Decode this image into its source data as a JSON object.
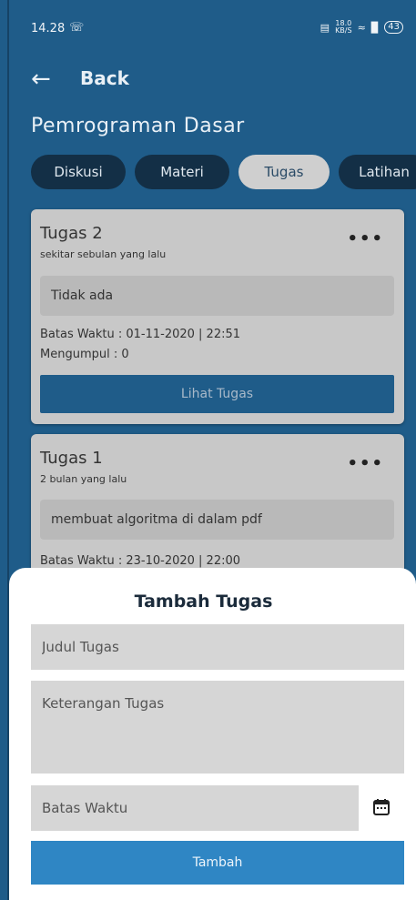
{
  "status_bar": {
    "time": "14.28",
    "speed_top": "18.0",
    "speed_bottom": "KB/S",
    "battery": "43"
  },
  "header": {
    "back_label": "Back"
  },
  "course_title": "Pemrograman Dasar",
  "tabs": [
    {
      "label": "Diskusi",
      "active": false
    },
    {
      "label": "Materi",
      "active": false
    },
    {
      "label": "Tugas",
      "active": true
    },
    {
      "label": "Latihan",
      "active": false
    }
  ],
  "tasks": [
    {
      "title": "Tugas 2",
      "time_ago": "sekitar sebulan yang lalu",
      "description": "Tidak ada",
      "deadline": "Batas Waktu : 01-11-2020 | 22:51",
      "submissions": "Mengumpul : 0",
      "button_label": "Lihat Tugas"
    },
    {
      "title": "Tugas 1",
      "time_ago": "2 bulan yang lalu",
      "description": "membuat algoritma di dalam pdf",
      "deadline": "Batas Waktu : 23-10-2020 | 22:00"
    }
  ],
  "add_task_sheet": {
    "title": "Tambah Tugas",
    "title_placeholder": "Judul Tugas",
    "description_placeholder": "Keterangan Tugas",
    "deadline_placeholder": "Batas Waktu",
    "submit_label": "Tambah"
  },
  "colors": {
    "primary": "#1f5c89",
    "accent": "#2f86c4",
    "card": "#c8c8c8"
  }
}
